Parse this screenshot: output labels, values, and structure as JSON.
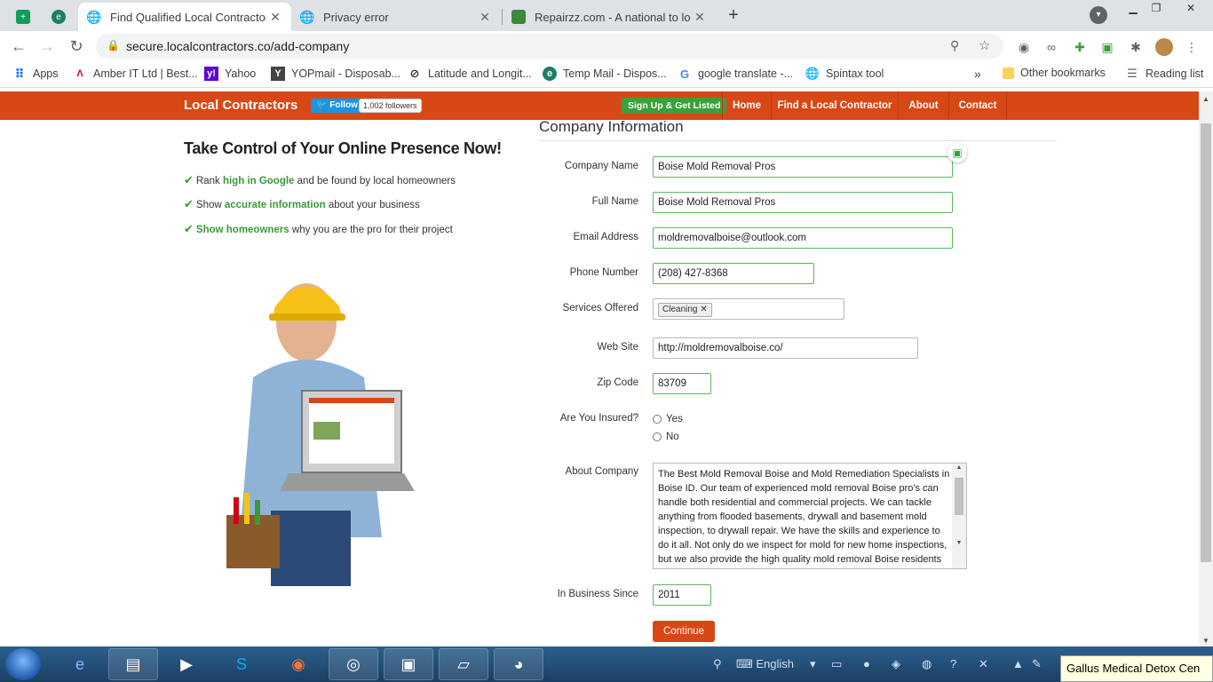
{
  "browser": {
    "tabs": [
      {
        "title": "",
        "icon": "sheets-icon",
        "color": "#0f9d58"
      },
      {
        "title": "",
        "icon": "extension-icon",
        "color": "#1a7f64"
      },
      {
        "title": "Find Qualified Local Contractors",
        "icon": "globe-icon",
        "active": true
      },
      {
        "title": "Privacy error",
        "icon": "globe-icon"
      },
      {
        "title": "Repairzz.com - A national to loca",
        "icon": "green-square-icon",
        "color": "#3b8a3b"
      }
    ],
    "url": "secure.localcontractors.co/add-company",
    "bookmarks": [
      {
        "label": "Apps",
        "icon": "apps-grid-icon"
      },
      {
        "label": "Amber IT Ltd | Best...",
        "icon": "amber-icon"
      },
      {
        "label": "Yahoo",
        "icon": "yahoo-icon"
      },
      {
        "label": "YOPmail - Disposab...",
        "icon": "yopmail-icon"
      },
      {
        "label": "Latitude and Longit...",
        "icon": "compass-icon"
      },
      {
        "label": "Temp Mail - Dispos...",
        "icon": "tempmail-icon"
      },
      {
        "label": "google translate -...",
        "icon": "google-icon"
      },
      {
        "label": "Spintax tool",
        "icon": "globe-icon"
      }
    ],
    "overflow": "»",
    "other_bookmarks": "Other bookmarks",
    "reading_list": "Reading list"
  },
  "site": {
    "brand": "Local Contractors",
    "twitter_follow": "Follow",
    "followers": "1,002 followers",
    "signup": "Sign Up & Get Listed",
    "nav": [
      "Home",
      "Find a Local Contractor",
      "About",
      "Contact"
    ],
    "brand_color": "#d84816"
  },
  "promo": {
    "title": "Take Control of Your Online Presence Now!",
    "items": [
      {
        "pre": "Rank ",
        "bold": "high in Google",
        "post": " and be found by local homeowners"
      },
      {
        "pre": "Show ",
        "bold": "accurate information",
        "post": " about your business"
      },
      {
        "pre": "",
        "bold": "Show homeowners",
        "post": " why you are the pro for their project"
      }
    ]
  },
  "form": {
    "section_title": "Company Information",
    "company_name_label": "Company Name",
    "company_name": "Boise Mold Removal Pros",
    "full_name_label": "Full Name",
    "full_name": "Boise Mold Removal Pros",
    "email_label": "Email Address",
    "email": "moldremovalboise@outlook.com",
    "phone_label": "Phone Number",
    "phone": "(208) 427-8368",
    "services_label": "Services Offered",
    "service_tag": "Cleaning",
    "website_label": "Web Site",
    "website": "http://moldremovalboise.co/",
    "zip_label": "Zip Code",
    "zip": "83709",
    "insured_label": "Are You Insured?",
    "insured_yes": "Yes",
    "insured_no": "No",
    "about_label": "About Company",
    "about": " The Best Mold Removal Boise and Mold Remediation Specialists in Boise ID. Our team of experienced mold removal Boise pro's can handle both residential and commercial projects. We can tackle anything from flooded basements, drywall and basement mold inspection, to drywall repair. We have the skills and experience to do it all. Not only do we inspect for mold for new home inspections, but we also provide the high quality mold removal Boise residents expect. Our company offers",
    "since_label": "In Business Since",
    "since": "2011",
    "continue": "Continue"
  },
  "taskbar": {
    "language": "English",
    "notification": "Gallus Medical Detox Cen"
  }
}
